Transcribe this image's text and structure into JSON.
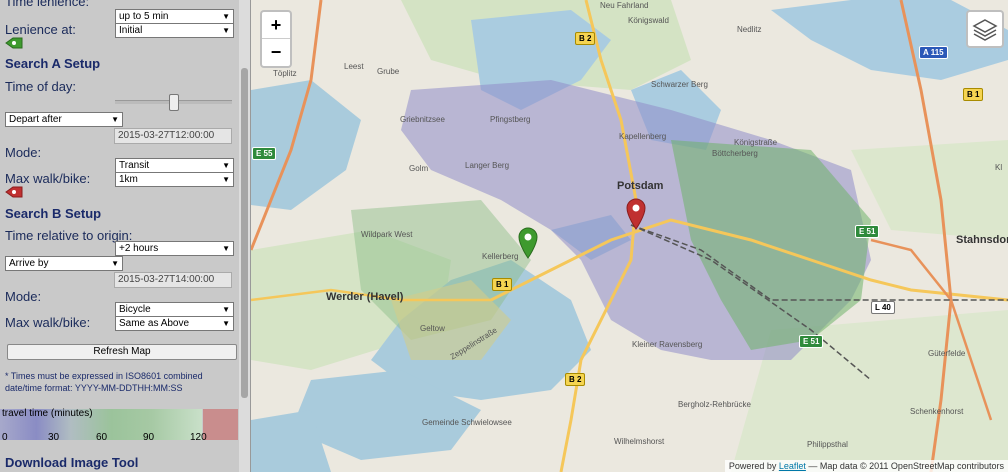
{
  "sidebar": {
    "time_lenience_label": "Time lenience:",
    "time_lenience_value": "up to 5 min",
    "lenience_at_label": "Lenience at:",
    "lenience_at_value": "Initial",
    "search_a": {
      "title": "Search A Setup",
      "time_of_day_label": "Time of day:",
      "depart_mode": "Depart after",
      "datetime": "2015-03-27T12:00:00",
      "mode_label": "Mode:",
      "mode_value": "Transit",
      "max_walk_label": "Max walk/bike:",
      "max_walk_value": "1km",
      "marker_color": "#3e9a2e"
    },
    "search_b": {
      "title": "Search B Setup",
      "time_rel_label": "Time relative to origin:",
      "time_rel_value": "+2 hours",
      "arrive_mode": "Arrive by",
      "datetime": "2015-03-27T14:00:00",
      "mode_label": "Mode:",
      "mode_value": "Bicycle",
      "max_walk_label": "Max walk/bike:",
      "max_walk_value": "Same as Above",
      "marker_color": "#c03030"
    },
    "refresh_button": "Refresh Map",
    "note_line1": "* Times must be expressed in ISO8601 combined",
    "note_line2": "date/time format: YYYY-MM-DDTHH:MM:SS",
    "legend": {
      "title": "travel time (minutes)",
      "ticks": [
        "0",
        "30",
        "60",
        "90",
        "120"
      ]
    },
    "download_title": "Download Image Tool"
  },
  "map": {
    "zoom_in": "+",
    "zoom_out": "−",
    "attribution_prefix": "Powered by",
    "attribution_link": "Leaflet",
    "attribution_suffix": "— Map data © 2011 OpenStreetMap contributors",
    "cities": {
      "potsdam": "Potsdam",
      "werder": "Werder (Havel)",
      "stahnsdorf": "Stahnsdor"
    },
    "places": {
      "neu_fahrland": "Neu Fahrland",
      "koenigswald": "Königswald",
      "nedlitz": "Nedlitz",
      "leest": "Leest",
      "toeplitz": "Töplitz",
      "grube": "Grube",
      "schwarzer_berg": "Schwarzer Berg",
      "kapellenberg": "Kapellenberg",
      "koenigstrasse": "Königstraße",
      "boettcherberg": "Böttcherberg",
      "griebnitzsee": "Griebnitzsee",
      "golm": "Golm",
      "langer_berg": "Langer Berg",
      "pfingstberg": "Pfingstberg",
      "wildpark_west": "Wildpark West",
      "kellerberg": "Kellerberg",
      "geltow": "Geltow",
      "kleiner_ravensberg": "Kleiner Ravensberg",
      "bergholz": "Bergholz-Rehbrücke",
      "gemeinde": "Gemeinde Schwielowsee",
      "wilhelmshorst": "Wilhelmshorst",
      "philippsthal": "Philippsthal",
      "gueterfelde": "Güterfelde",
      "schenkenhorst": "Schenkenhorst",
      "tremmen": "Zeppelinstraße",
      "k": "Kl"
    },
    "shields": {
      "b2_top": "B 2",
      "b2_bottom": "B 2",
      "b1_left": "B 1",
      "b1_right": "B 1",
      "e55": "E 55",
      "e51_a": "E 51",
      "e51_b": "E 51",
      "a115": "A 115",
      "l40": "L 40"
    }
  }
}
